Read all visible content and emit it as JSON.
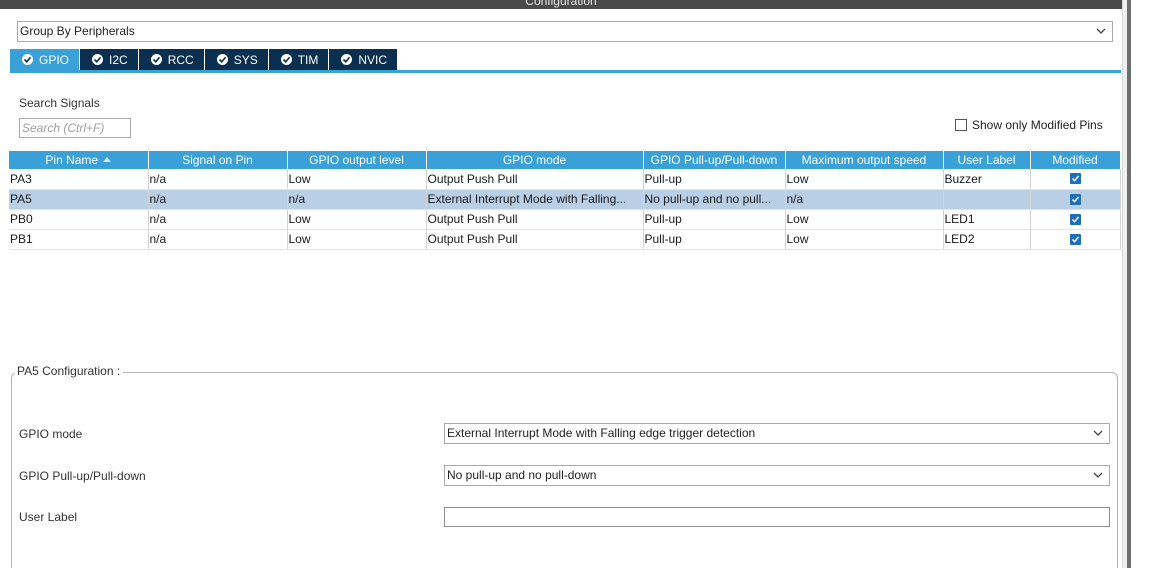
{
  "window": {
    "title": "Configuration"
  },
  "group_by": {
    "value": "Group By Peripherals"
  },
  "tabs": [
    {
      "label": "GPIO",
      "active": true
    },
    {
      "label": "I2C",
      "active": false
    },
    {
      "label": "RCC",
      "active": false
    },
    {
      "label": "SYS",
      "active": false
    },
    {
      "label": "TIM",
      "active": false
    },
    {
      "label": "NVIC",
      "active": false
    }
  ],
  "search": {
    "label": "Search Signals",
    "placeholder": "Search (Ctrl+F)"
  },
  "show_modified": {
    "label": "Show only Modified Pins",
    "checked": false
  },
  "table": {
    "headers": [
      "Pin Name",
      "Signal on Pin",
      "GPIO output level",
      "GPIO mode",
      "GPIO Pull-up/Pull-down",
      "Maximum output speed",
      "User Label",
      "Modified"
    ],
    "rows": [
      {
        "pin": "PA3",
        "signal": "n/a",
        "level": "Low",
        "mode": "Output Push Pull",
        "pull": "Pull-up",
        "speed": "Low",
        "label": "Buzzer",
        "modified": true,
        "selected": false
      },
      {
        "pin": "PA5",
        "signal": "n/a",
        "level": "n/a",
        "mode": "External Interrupt Mode with Falling...",
        "pull": "No pull-up and no pull...",
        "speed": "n/a",
        "label": "",
        "modified": true,
        "selected": true
      },
      {
        "pin": "PB0",
        "signal": "n/a",
        "level": "Low",
        "mode": "Output Push Pull",
        "pull": "Pull-up",
        "speed": "Low",
        "label": "LED1",
        "modified": true,
        "selected": false
      },
      {
        "pin": "PB1",
        "signal": "n/a",
        "level": "Low",
        "mode": "Output Push Pull",
        "pull": "Pull-up",
        "speed": "Low",
        "label": "LED2",
        "modified": true,
        "selected": false
      }
    ]
  },
  "pin_config": {
    "title": "PA5 Configuration :",
    "gpio_mode_label": "GPIO mode",
    "gpio_mode_value": "External Interrupt Mode with Falling edge trigger detection",
    "pull_label": "GPIO Pull-up/Pull-down",
    "pull_value": "No pull-up and no pull-down",
    "user_label_label": "User Label",
    "user_label_value": ""
  },
  "colors": {
    "accent": "#3aa0d8",
    "tab_dark": "#0b2f4f",
    "selected_row": "#b9cfe6",
    "title_bar": "#4a4a4a"
  }
}
